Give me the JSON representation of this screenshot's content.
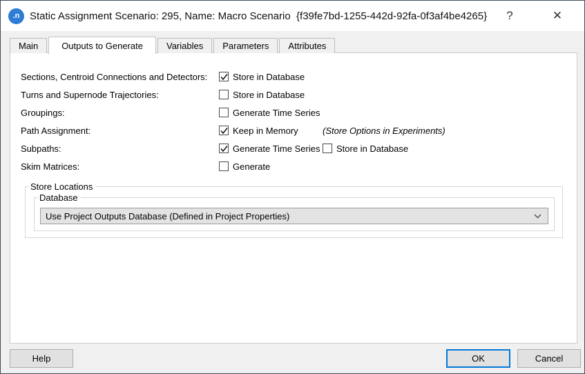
{
  "window": {
    "title": "Static Assignment Scenario: 295, Name: Macro Scenario  {f39fe7bd-1255-442d-92fa-0f3af4be4265}",
    "logo_text": ".n",
    "help_glyph": "?",
    "close_glyph": "✕"
  },
  "colors": {
    "accent_blue": "#0078d7",
    "logo_blue": "#2e7cd6"
  },
  "tabs": [
    {
      "label": "Main",
      "active": false
    },
    {
      "label": "Outputs to Generate",
      "active": true
    },
    {
      "label": "Variables",
      "active": false
    },
    {
      "label": "Parameters",
      "active": false
    },
    {
      "label": "Attributes",
      "active": false
    }
  ],
  "rows": [
    {
      "label": "Sections, Centroid Connections and Detectors:",
      "checks": [
        {
          "label": "Store in Database",
          "checked": true
        }
      ]
    },
    {
      "label": "Turns and Supernode Trajectories:",
      "checks": [
        {
          "label": "Store in Database",
          "checked": false
        }
      ]
    },
    {
      "label": "Groupings:",
      "checks": [
        {
          "label": "Generate Time Series",
          "checked": false
        }
      ]
    },
    {
      "label": "Path Assignment:",
      "checks": [
        {
          "label": "Keep in Memory",
          "checked": true
        }
      ],
      "note": "(Store Options in Experiments)"
    },
    {
      "label": "Subpaths:",
      "checks": [
        {
          "label": "Generate Time Series",
          "checked": true
        },
        {
          "label": "Store in Database",
          "checked": false
        }
      ]
    },
    {
      "label": "Skim Matrices:",
      "checks": [
        {
          "label": "Generate",
          "checked": false
        }
      ]
    }
  ],
  "store_locations": {
    "group_label": "Store Locations",
    "database_group_label": "Database",
    "database_selected_value": "Use Project Outputs Database (Defined in Project Properties)"
  },
  "footer": {
    "help_label": "Help",
    "ok_label": "OK",
    "cancel_label": "Cancel"
  }
}
